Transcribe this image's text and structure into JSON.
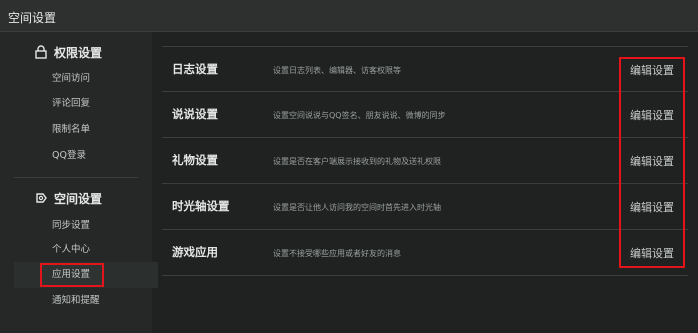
{
  "window": {
    "title": "空间设置"
  },
  "sidebar": {
    "groups": [
      {
        "title": "权限设置",
        "icon": "lock-icon",
        "items": [
          "空间访问",
          "评论回复",
          "限制名单",
          "QQ登录"
        ]
      },
      {
        "title": "空间设置",
        "icon": "gear-icon",
        "items": [
          "同步设置",
          "个人中心",
          "应用设置",
          "通知和提醒"
        ]
      }
    ],
    "active_item": "应用设置"
  },
  "main": {
    "rows": [
      {
        "name": "日志设置",
        "desc": "设置日志列表、编辑器、访客权限等",
        "action": "编辑设置"
      },
      {
        "name": "说说设置",
        "desc": "设置空间说说与QQ签名、朋友说说、微博的同步",
        "action": "编辑设置"
      },
      {
        "name": "礼物设置",
        "desc": "设置是否在客户端展示接收到的礼物及送礼权限",
        "action": "编辑设置"
      },
      {
        "name": "时光轴设置",
        "desc": "设置是否让他人访问我的空间时首先进入时光轴",
        "action": "编辑设置"
      },
      {
        "name": "游戏应用",
        "desc": "设置不接受哪些应用或者好友的消息",
        "action": "编辑设置"
      }
    ]
  },
  "colors": {
    "background": "#1f2221",
    "sidebar": "#252827",
    "highlight": "#e4141b",
    "text": "#e4e6e5"
  }
}
